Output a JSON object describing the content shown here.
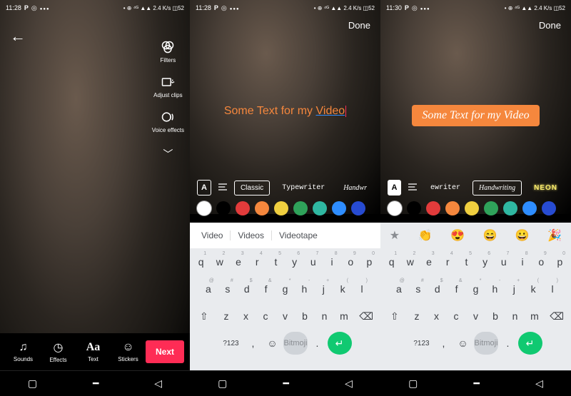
{
  "status": {
    "times": [
      "11:28",
      "11:28",
      "11:30"
    ],
    "p": "P",
    "o": "◎",
    "right_icons": "• ⊕ ⁴ᴳ ▲▲ 2.4 K/s ◫52",
    "dots": "•••"
  },
  "screen1": {
    "tools": {
      "filters": "Filters",
      "adjust": "Adjust clips",
      "voice": "Voice effects"
    },
    "bottom": {
      "sounds": "Sounds",
      "effects": "Effects",
      "text": "Text",
      "stickers": "Stickers",
      "next": "Next"
    }
  },
  "editor": {
    "done": "Done",
    "text_prefix": "Some Text for my ",
    "text_word": "Video",
    "text_full": "Some Text for my Video",
    "fonts": {
      "classic": "Classic",
      "typewriter": "Typewriter",
      "handwriting_cut": "Handwr",
      "ewriter": "ewriter",
      "handwriting": "Handwriting",
      "neon": "NEON"
    },
    "style_A": "A"
  },
  "colors": [
    "#ffffff",
    "#000000",
    "#e23b3b",
    "#f5873d",
    "#f0cf3f",
    "#2fa25a",
    "#2fb7a1",
    "#2e8dff",
    "#274bd1"
  ],
  "suggestions": [
    "Video",
    "Videos",
    "Videotape"
  ],
  "emoji_row": [
    "★",
    "👏",
    "😍",
    "😄",
    "😀",
    "🎉"
  ],
  "keyboard": {
    "row1": [
      [
        "q",
        "1"
      ],
      [
        "w",
        "2"
      ],
      [
        "e",
        "3"
      ],
      [
        "r",
        "4"
      ],
      [
        "t",
        "5"
      ],
      [
        "y",
        "6"
      ],
      [
        "u",
        "7"
      ],
      [
        "i",
        "8"
      ],
      [
        "o",
        "9"
      ],
      [
        "p",
        "0"
      ]
    ],
    "row2": [
      [
        "a",
        "@"
      ],
      [
        "s",
        "#"
      ],
      [
        "d",
        "$"
      ],
      [
        "f",
        "&"
      ],
      [
        "g",
        "*"
      ],
      [
        "h",
        "-"
      ],
      [
        "j",
        "+"
      ],
      [
        "k",
        "("
      ],
      [
        "l",
        ")"
      ]
    ],
    "row3": [
      "z",
      "x",
      "c",
      "v",
      "b",
      "n",
      "m"
    ],
    "shift": "⇧",
    "bksp": "⌫",
    "sym": "?123",
    "comma": ",",
    "dot": ".",
    "space": "Bitmoji",
    "enter": "↵"
  },
  "nav": {
    "back": "◁",
    "home": "▭",
    "recent": "◁"
  }
}
